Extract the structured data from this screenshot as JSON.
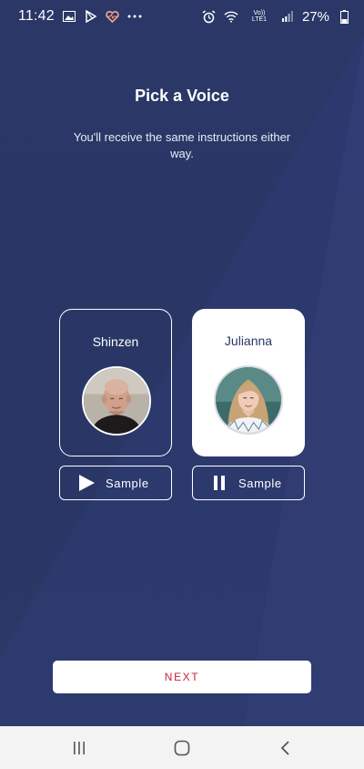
{
  "status_bar": {
    "time": "11:42",
    "battery_percent": "27%",
    "signal_label": "Vo)) LTE1"
  },
  "header": {
    "title": "Pick a Voice",
    "subtitle": "You'll receive the same instructions either way."
  },
  "voices": [
    {
      "name": "Shinzen",
      "selected": false,
      "sample_label": "Sample",
      "sample_state": "play-icon"
    },
    {
      "name": "Julianna",
      "selected": true,
      "sample_label": "Sample",
      "sample_state": "pause-icon"
    }
  ],
  "footer": {
    "next_label": "NEXT"
  },
  "colors": {
    "background": "#2a3767",
    "accent_text": "#c9223a",
    "card_selected": "#ffffff"
  }
}
